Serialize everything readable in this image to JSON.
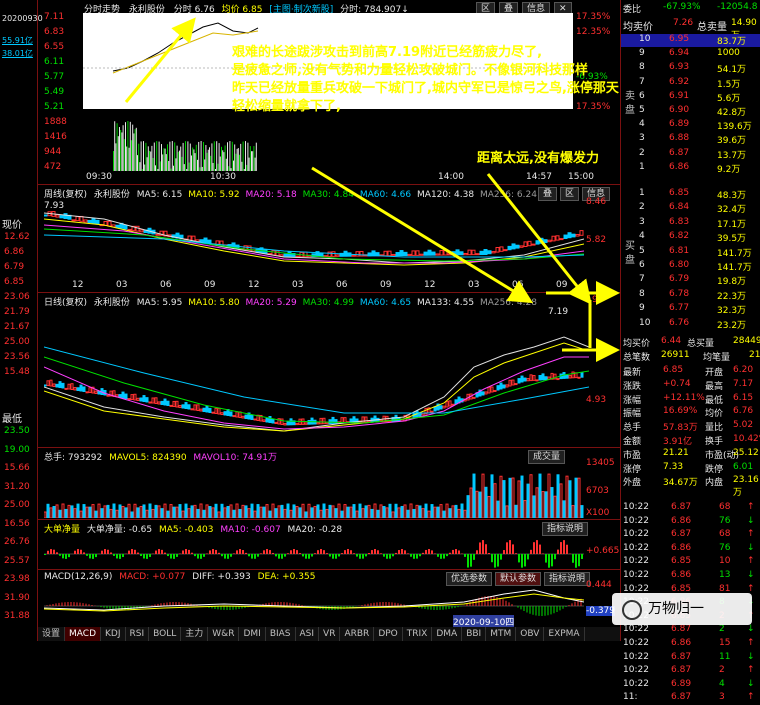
{
  "left_panel": {
    "date": "20200930",
    "val1": "55.91亿",
    "val2": "38.01亿",
    "current_label": "现价",
    "prices": [
      "12.62",
      "6.86",
      "6.79",
      "6.85",
      "23.06",
      "21.79",
      "21.67",
      "25.00",
      "23.56",
      "15.48"
    ],
    "low_label": "最低",
    "lows": [
      "23.50",
      "19.00",
      "15.66",
      "31.20",
      "25.00",
      "16.56",
      "26.76",
      "25.57",
      "23.98",
      "31.90",
      "31.88"
    ]
  },
  "intraday": {
    "title": "分时走势",
    "stock": "永利股份",
    "time_label": "分时 6.76",
    "avg_label": "均价 6.85",
    "sys": "[主图·制次新股]",
    "vol": "分时: 784.907↓",
    "y_left": [
      "7.11",
      "6.83",
      "6.55",
      "6.11",
      "5.77",
      "5.49",
      "5.21",
      "1888",
      "1416",
      "944",
      "472"
    ],
    "y_right": [
      "17.35%",
      "12.35%",
      "",
      "",
      "-6.93%",
      "",
      "17.35%",
      "",
      "",
      ""
    ],
    "x_labels": [
      "09:30",
      "10:30",
      "14:00",
      "14:57",
      "15:00"
    ],
    "buttons": [
      "区",
      "叠",
      "信息"
    ]
  },
  "weekly": {
    "title": "周线(复权)",
    "stock": "永利股份",
    "ma5": "MA5: 6.15",
    "ma10": "MA10: 5.92",
    "ma20": "MA20: 5.18",
    "ma30": "MA30: 4.84",
    "ma60": "MA60: 4.66",
    "ma120": "MA120: 4.38",
    "ma256": "MA256: 6.24",
    "y_top": "7.93",
    "y_right_top": "8.46",
    "y_right_mid": "5.82",
    "x_labels": [
      "12",
      "03",
      "06",
      "09",
      "12",
      "03",
      "06",
      "09",
      "12",
      "03",
      "06",
      "09"
    ],
    "buttons": [
      "叠",
      "区",
      "信息"
    ]
  },
  "daily": {
    "title": "日线(复权)",
    "stock": "永利股份",
    "ma5": "MA5: 5.95",
    "ma10": "MA10: 5.80",
    "ma20": "MA20: 5.29",
    "ma30": "MA30: 4.99",
    "ma60": "MA60: 4.65",
    "ma133": "MA133: 4.55",
    "ma256": "MA256: 4.28",
    "high_mark": "7.19",
    "y_right_top": "9",
    "y_right_mid": "4.93"
  },
  "volume": {
    "title": "总手: 793292",
    "mavol5": "MAVOL5: 824390",
    "mavol10": "MAVOL10: 74.91万",
    "y_right": [
      "13405",
      "6703",
      "X100"
    ],
    "button": "成交量"
  },
  "bignet": {
    "title": "大单净量",
    "sub": "大单净量: -0.65",
    "ma5": "MA5: -0.403",
    "ma10": "MA10: -0.607",
    "ma20": "MA20: -0.28",
    "y_right": [
      "+0.665"
    ],
    "button": "指标说明"
  },
  "macd": {
    "title": "MACD(12,26,9)",
    "macd": "MACD: +0.077",
    "diff": "DIFF: +0.393",
    "dea": "DEA: +0.355",
    "y_right": [
      "0.444",
      "-0.379"
    ],
    "btn1": "优选参数",
    "btn2": "默认参数",
    "btn3": "指标说明",
    "date_stamp": "2020-09-10四"
  },
  "bottom_tabs": [
    "设置",
    "MACD",
    "KDJ",
    "RSI",
    "BOLL",
    "主力",
    "W&R",
    "DMI",
    "BIAS",
    "ASI",
    "VR",
    "ARBR",
    "DPO",
    "TRIX",
    "DMA",
    "BBI",
    "MTM",
    "OBV",
    "EXPMA"
  ],
  "right_panel": {
    "weibi_label": "委比",
    "weibi": "-67.93%",
    "weicha": "-12054.8",
    "avg_label": "均卖价",
    "avg_sell": "7.26",
    "total_sell_label": "总卖量",
    "total_sell": "14.90万",
    "sell_orders": [
      {
        "n": "10",
        "p": "6.95",
        "v": "83.7万"
      },
      {
        "n": "9",
        "p": "6.94",
        "v": "1000"
      },
      {
        "n": "8",
        "p": "6.93",
        "v": "54.1万"
      },
      {
        "n": "7",
        "p": "6.92",
        "v": "1.5万"
      },
      {
        "n": "6",
        "p": "6.91",
        "v": "5.6万"
      },
      {
        "n": "5",
        "p": "6.90",
        "v": "42.8万"
      },
      {
        "n": "4",
        "p": "6.89",
        "v": "139.6万"
      },
      {
        "n": "3",
        "p": "6.88",
        "v": "39.6万"
      },
      {
        "n": "2",
        "p": "6.87",
        "v": "13.7万"
      },
      {
        "n": "1",
        "p": "6.86",
        "v": "9.2万"
      }
    ],
    "sell_side_label": "卖盘",
    "buy_orders": [
      {
        "n": "1",
        "p": "6.85",
        "v": "48.3万"
      },
      {
        "n": "2",
        "p": "6.84",
        "v": "32.4万"
      },
      {
        "n": "3",
        "p": "6.83",
        "v": "17.1万"
      },
      {
        "n": "4",
        "p": "6.82",
        "v": "39.5万"
      },
      {
        "n": "5",
        "p": "6.81",
        "v": "141.7万"
      },
      {
        "n": "6",
        "p": "6.80",
        "v": "141.7万"
      },
      {
        "n": "7",
        "p": "6.79",
        "v": "19.8万"
      },
      {
        "n": "8",
        "p": "6.78",
        "v": "22.3万"
      },
      {
        "n": "9",
        "p": "6.77",
        "v": "32.3万"
      },
      {
        "n": "10",
        "p": "6.76",
        "v": "23.2万"
      }
    ],
    "buy_side_label": "买盘",
    "avg_buy_label": "均买价",
    "avg_buy": "6.44",
    "total_buy_label": "总买量",
    "total_buy": "28449",
    "bishu_label": "总笔数",
    "bishu": "26911",
    "junbi_label": "均笔量",
    "junbi": "21",
    "stats": [
      {
        "k1": "最新",
        "v1": "6.85",
        "k2": "开盘",
        "v2": "6.20"
      },
      {
        "k1": "涨跌",
        "v1": "+0.74",
        "k2": "最高",
        "v2": "7.17"
      },
      {
        "k1": "涨幅",
        "v1": "+12.11%",
        "k2": "最低",
        "v2": "6.15"
      },
      {
        "k1": "振幅",
        "v1": "16.69%",
        "k2": "均价",
        "v2": "6.76"
      },
      {
        "k1": "总手",
        "v1": "57.83万",
        "k2": "量比",
        "v2": "5.02"
      },
      {
        "k1": "金额",
        "v1": "3.91亿",
        "k2": "换手",
        "v2": "10.42%"
      },
      {
        "k1": "市盈",
        "v1": "21.21",
        "k2": "市盈(动)",
        "v2": "25.12"
      },
      {
        "k1": "涨停",
        "v1": "7.33",
        "k2": "跌停",
        "v2": "6.01"
      },
      {
        "k1": "外盘",
        "v1": "34.67万",
        "k2": "内盘",
        "v2": "23.16万"
      }
    ],
    "ticks": [
      {
        "t": "10:22",
        "p": "6.87",
        "v": "68"
      },
      {
        "t": "10:22",
        "p": "6.86",
        "v": "76"
      },
      {
        "t": "10:22",
        "p": "6.87",
        "v": "68"
      },
      {
        "t": "10:22",
        "p": "6.86",
        "v": "76"
      },
      {
        "t": "10:22",
        "p": "6.85",
        "v": "10"
      },
      {
        "t": "10:22",
        "p": "6.86",
        "v": "13"
      },
      {
        "t": "10:22",
        "p": "6.85",
        "v": "81"
      },
      {
        "t": "10:22",
        "p": "6.86",
        "v": "8"
      },
      {
        "t": "10:22",
        "p": "6.85",
        "v": "2"
      },
      {
        "t": "10:22",
        "p": "6.87",
        "v": "2"
      },
      {
        "t": "10:22",
        "p": "6.86",
        "v": "15"
      },
      {
        "t": "10:22",
        "p": "6.87",
        "v": "11"
      },
      {
        "t": "10:22",
        "p": "6.87",
        "v": "2"
      },
      {
        "t": "10:22",
        "p": "6.89",
        "v": "4"
      },
      {
        "t": "11:",
        "p": "6.87",
        "v": "3"
      }
    ]
  },
  "annotations": {
    "main_line1": "艰难的长途跋涉攻击到前高7.19附近已经筋疲力尽了,",
    "main_line2": "是疲惫之师,没有气势和力量轻松攻破城门。不像银河科技那样",
    "main_line3": "昨天已经放量重兵攻破一下城门了,城内守军已是惊弓之鸟,涨停那天",
    "main_line4": "轻松缩量就拿下了,",
    "second": "距离太远,没有爆发力"
  },
  "logo_text": "万物归一"
}
